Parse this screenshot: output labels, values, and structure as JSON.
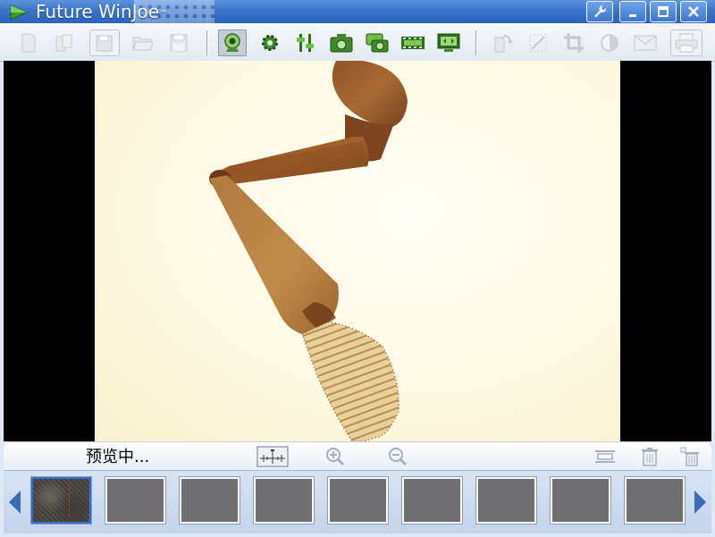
{
  "window": {
    "title": "Future WinJoe",
    "trademark": "™"
  },
  "title_buttons": [
    {
      "name": "tools-button",
      "icon": "wrench-icon"
    },
    {
      "name": "minimize-button",
      "icon": "minimize-icon"
    },
    {
      "name": "maximize-button",
      "icon": "maximize-icon"
    },
    {
      "name": "close-button",
      "icon": "close-icon"
    }
  ],
  "toolbar": {
    "tools": [
      {
        "name": "new-file-button",
        "icon": "new-file-icon",
        "enabled": false
      },
      {
        "name": "copy-file-button",
        "icon": "copy-file-icon",
        "enabled": false
      },
      {
        "name": "save-all-button",
        "icon": "save-all-icon",
        "enabled": false
      },
      {
        "name": "open-folder-button",
        "icon": "folder-open-icon",
        "enabled": false
      },
      {
        "name": "save-button",
        "icon": "save-icon",
        "enabled": false
      },
      {
        "name": "preview-camera-button",
        "icon": "webcam-icon",
        "enabled": true,
        "pressed": true
      },
      {
        "name": "settings-button",
        "icon": "gear-icon",
        "enabled": true
      },
      {
        "name": "adjust-button",
        "icon": "sliders-icon",
        "enabled": true
      },
      {
        "name": "capture-button",
        "icon": "camera-icon",
        "enabled": true
      },
      {
        "name": "burst-capture-button",
        "icon": "multi-camera-icon",
        "enabled": true
      },
      {
        "name": "record-video-button",
        "icon": "film-strip-icon",
        "enabled": true
      },
      {
        "name": "fullscreen-button",
        "icon": "monitor-icon",
        "enabled": true
      },
      {
        "name": "rotate-button",
        "icon": "rotate-icon",
        "enabled": false
      },
      {
        "name": "measure-button",
        "icon": "measure-icon",
        "enabled": false
      },
      {
        "name": "crop-button",
        "icon": "crop-icon",
        "enabled": false
      },
      {
        "name": "contrast-button",
        "icon": "contrast-icon",
        "enabled": false
      },
      {
        "name": "email-button",
        "icon": "envelope-icon",
        "enabled": false
      },
      {
        "name": "print-button",
        "icon": "printer-icon",
        "enabled": false
      }
    ]
  },
  "status": {
    "text": "预览中..."
  },
  "actions": [
    {
      "name": "scale-ruler-button",
      "icon": "ruler-icon",
      "enabled": true
    },
    {
      "name": "zoom-in-button",
      "icon": "zoom-in-icon",
      "enabled": false
    },
    {
      "name": "zoom-out-button",
      "icon": "zoom-out-icon",
      "enabled": false
    },
    {
      "name": "fit-width-button",
      "icon": "fit-width-icon",
      "enabled": false
    },
    {
      "name": "delete-button",
      "icon": "trash-icon",
      "enabled": false
    },
    {
      "name": "delete-all-button",
      "icon": "trash-all-icon",
      "enabled": false
    }
  ],
  "thumbnails": {
    "count": 9,
    "active_index": 0
  },
  "colors": {
    "titlebar": "#3a73c9",
    "accent": "#2e6fd8",
    "toolbar_icon_active": "#2f6b1f",
    "toolbar_icon_disabled": "#c7ccd3"
  }
}
